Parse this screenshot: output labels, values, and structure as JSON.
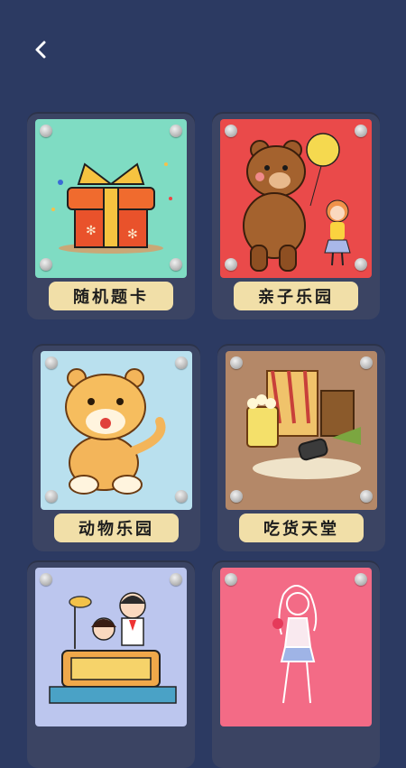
{
  "nav": {
    "back_icon": "chevron-left-icon"
  },
  "cards": [
    {
      "label": "随机题卡",
      "bg": "#7fdcc3",
      "illustration": "gift-box"
    },
    {
      "label": "亲子乐园",
      "bg": "#ea4a4a",
      "illustration": "bear-and-girl"
    },
    {
      "label": "动物乐园",
      "bg": "#b9e0ee",
      "illustration": "tiger"
    },
    {
      "label": "吃货天堂",
      "bg": "#b48868",
      "illustration": "popcorn-snacks"
    },
    {
      "label": "",
      "bg": "#bcc6ee",
      "illustration": "children-studying"
    },
    {
      "label": "",
      "bg": "#f36b86",
      "illustration": "girl-sketch"
    }
  ]
}
